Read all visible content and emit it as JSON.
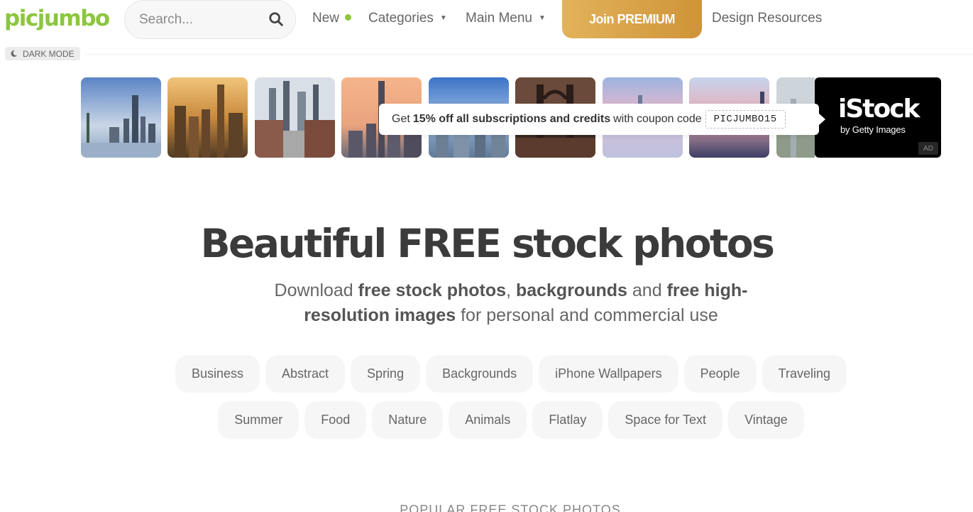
{
  "header": {
    "logo": "picjumbo",
    "search": {
      "placeholder": "Search..."
    },
    "nav": {
      "new": "New",
      "categories": "Categories",
      "main_menu": "Main Menu",
      "design_resources": "Design Resources"
    },
    "premium_button": "Join PREMIUM",
    "dark_mode": "DARK MODE",
    "accent_color": "#8cc63f"
  },
  "ad": {
    "coupon_prefix": "Get",
    "coupon_bold": "15% off all subscriptions and credits",
    "coupon_suffix": "with coupon code",
    "coupon_code": "PICJUMBO15",
    "brand": "iStock",
    "brand_sub": "by Getty Images",
    "ad_label": "AD"
  },
  "hero": {
    "title": "Beautiful FREE stock photos",
    "sub_1": "Download",
    "sub_2": "free stock photos",
    "sub_3": ",",
    "sub_4": "backgrounds",
    "sub_5": "and",
    "sub_6": "free high-resolution images",
    "sub_7": "for personal and commercial use"
  },
  "categories": [
    "Business",
    "Abstract",
    "Spring",
    "Backgrounds",
    "iPhone Wallpapers",
    "People",
    "Traveling",
    "Summer",
    "Food",
    "Nature",
    "Animals",
    "Flatlay",
    "Space for Text",
    "Vintage"
  ],
  "popular_heading": "POPULAR FREE STOCK PHOTOS"
}
